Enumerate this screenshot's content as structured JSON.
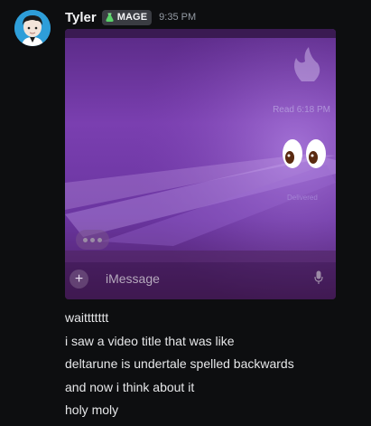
{
  "message": {
    "author": "Tyler",
    "role_badge": {
      "label": "MAGE",
      "icon": "potion-icon",
      "color": "#5bd36b"
    },
    "timestamp": "9:35 PM",
    "attachment": {
      "read_receipt": "Read 6:18 PM",
      "delivered": "Delivered",
      "input_placeholder": "iMessage",
      "plus_label": "+",
      "icons": [
        "plus-icon",
        "microphone-icon",
        "eyes-emoji",
        "flame-icon"
      ]
    },
    "lines": [
      "waittttttt",
      "i saw a video title that was like",
      "deltarune is undertale spelled backwards",
      "and now i think about it",
      "holy moly"
    ]
  },
  "colors": {
    "background": "#0d0e10",
    "avatar_bg": "#2e9ed9",
    "attachment_purple": "#7a3fb0"
  }
}
